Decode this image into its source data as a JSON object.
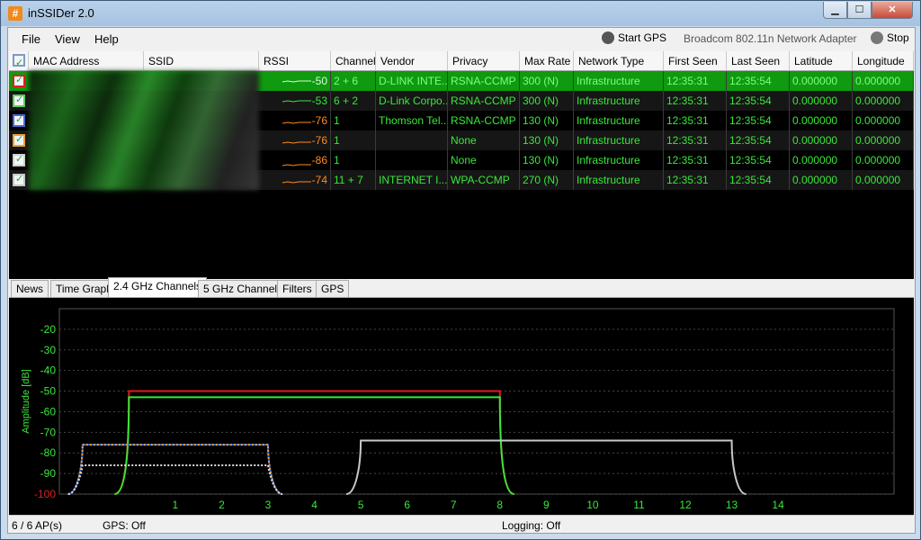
{
  "window": {
    "title": "inSSIDer 2.0",
    "icon": "#",
    "min_glyph": "▁",
    "max_glyph": "☐",
    "close_glyph": "✕"
  },
  "menu": {
    "file": "File",
    "view": "View",
    "help": "Help"
  },
  "toolbar": {
    "start_gps": "Start GPS",
    "adapter": "Broadcom 802.11n Network Adapter",
    "stop": "Stop"
  },
  "table": {
    "headers": [
      "MAC Address",
      "SSID",
      "RSSI",
      "Channel",
      "Vendor",
      "Privacy",
      "Max Rate",
      "Network Type",
      "First Seen",
      "Last Seen",
      "Latitude",
      "Longitude"
    ],
    "rows": [
      {
        "rssi": "-50",
        "channel": "2 + 6",
        "vendor": "D-LINK INTE...",
        "privacy": "RSNA-CCMP",
        "max_rate": "300 (N)",
        "network_type": "Infrastructure",
        "first_seen": "12:35:31",
        "last_seen": "12:35:54",
        "latitude": "0.000000",
        "longitude": "0.000000",
        "color": "#e02020",
        "row_bg": "#0f9a0f",
        "text": "#7dff7d",
        "rssi_color": "#d8ffd8"
      },
      {
        "rssi": "-53",
        "channel": "6 + 2",
        "vendor": "D-Link Corpo...",
        "privacy": "RSNA-CCMP",
        "max_rate": "300 (N)",
        "network_type": "Infrastructure",
        "first_seen": "12:35:31",
        "last_seen": "12:35:54",
        "latitude": "0.000000",
        "longitude": "0.000000",
        "color": "#5ad05a",
        "row_bg": "#161616",
        "text": "#38e838",
        "rssi_color": "#38e838"
      },
      {
        "rssi": "-76",
        "channel": "1",
        "vendor": "Thomson Tel...",
        "privacy": "RSNA-CCMP",
        "max_rate": "130 (N)",
        "network_type": "Infrastructure",
        "first_seen": "12:35:31",
        "last_seen": "12:35:54",
        "latitude": "0.000000",
        "longitude": "0.000000",
        "color": "#4a6ad8",
        "row_bg": "#000000",
        "text": "#38e838",
        "rssi_color": "#ff8a20"
      },
      {
        "rssi": "-76",
        "channel": "1",
        "vendor": "",
        "privacy": "None",
        "max_rate": "130 (N)",
        "network_type": "Infrastructure",
        "first_seen": "12:35:31",
        "last_seen": "12:35:54",
        "latitude": "0.000000",
        "longitude": "0.000000",
        "color": "#f0a030",
        "row_bg": "#161616",
        "text": "#38e838",
        "rssi_color": "#ff8a20"
      },
      {
        "rssi": "-86",
        "channel": "1",
        "vendor": "",
        "privacy": "None",
        "max_rate": "130 (N)",
        "network_type": "Infrastructure",
        "first_seen": "12:35:31",
        "last_seen": "12:35:54",
        "latitude": "0.000000",
        "longitude": "0.000000",
        "color": "#d0d0d0",
        "row_bg": "#000000",
        "text": "#38e838",
        "rssi_color": "#ff8a20"
      },
      {
        "rssi": "-74",
        "channel": "11 + 7",
        "vendor": "INTERNET I...",
        "privacy": "WPA-CCMP",
        "max_rate": "270 (N)",
        "network_type": "Infrastructure",
        "first_seen": "12:35:31",
        "last_seen": "12:35:54",
        "latitude": "0.000000",
        "longitude": "0.000000",
        "color": "#c8c8c8",
        "row_bg": "#161616",
        "text": "#38e838",
        "rssi_color": "#ff8a20"
      }
    ]
  },
  "tabs": [
    "News",
    "Time Graph",
    "2.4 GHz Channels",
    "5 GHz Channels",
    "Filters",
    "GPS"
  ],
  "active_tab": "2.4 GHz Channels",
  "status": {
    "ap_count": "6 / 6 AP(s)",
    "gps": "GPS: Off",
    "logging": "Logging: Off"
  },
  "chart_data": {
    "type": "line",
    "ylabel": "Amplitude [dB]",
    "ylim": [
      -100,
      -10
    ],
    "yticks": [
      -20,
      -30,
      -40,
      -50,
      -60,
      -70,
      -80,
      -90,
      -100
    ],
    "xticks": [
      1,
      2,
      3,
      4,
      5,
      6,
      7,
      8,
      9,
      10,
      11,
      12,
      13,
      14
    ],
    "x_range": [
      -1.5,
      16.5
    ],
    "grid": true,
    "series": [
      {
        "color": "#e01818",
        "center": 4,
        "half_width": 4,
        "level": -50,
        "style": "solid"
      },
      {
        "color": "#38e838",
        "center": 4,
        "half_width": 4,
        "level": -53,
        "style": "solid"
      },
      {
        "color": "#3060d8",
        "center": 1,
        "half_width": 2,
        "level": -76,
        "style": "solid"
      },
      {
        "color": "#f0a030",
        "center": 1,
        "half_width": 2,
        "level": -76,
        "style": "dotted"
      },
      {
        "color": "#dddddd",
        "center": 1,
        "half_width": 2,
        "level": -86,
        "style": "dotted"
      },
      {
        "color": "#c8c8c8",
        "center": 9,
        "half_width": 4,
        "level": -74,
        "style": "solid"
      }
    ]
  }
}
